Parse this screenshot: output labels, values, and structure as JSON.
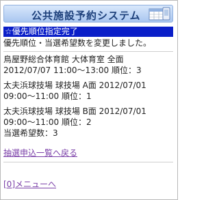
{
  "header": {
    "title": "公共施設予約システム",
    "icon": "calendar-booking-icon"
  },
  "notice": {
    "banner": "☆優先順位指定完了",
    "message": "優先順位・当選希望数を変更しました。"
  },
  "items": [
    {
      "line1": "鳥屋野総合体育館 大体育室 全面",
      "line2": "2012/07/07 11:00～13:00 順位：3"
    },
    {
      "line1": "太夫浜球技場 球技場 A面 2012/07/01",
      "line2": "09:00～11:00 順位：1"
    },
    {
      "line1": "太夫浜球技場 球技場 B面 2012/07/01",
      "line2": "09:00～11:00 順位：2"
    }
  ],
  "summary": "当選希望数：3",
  "links": {
    "back": "抽選申込一覧へ戻る",
    "menu": "[0]メニューへ"
  }
}
